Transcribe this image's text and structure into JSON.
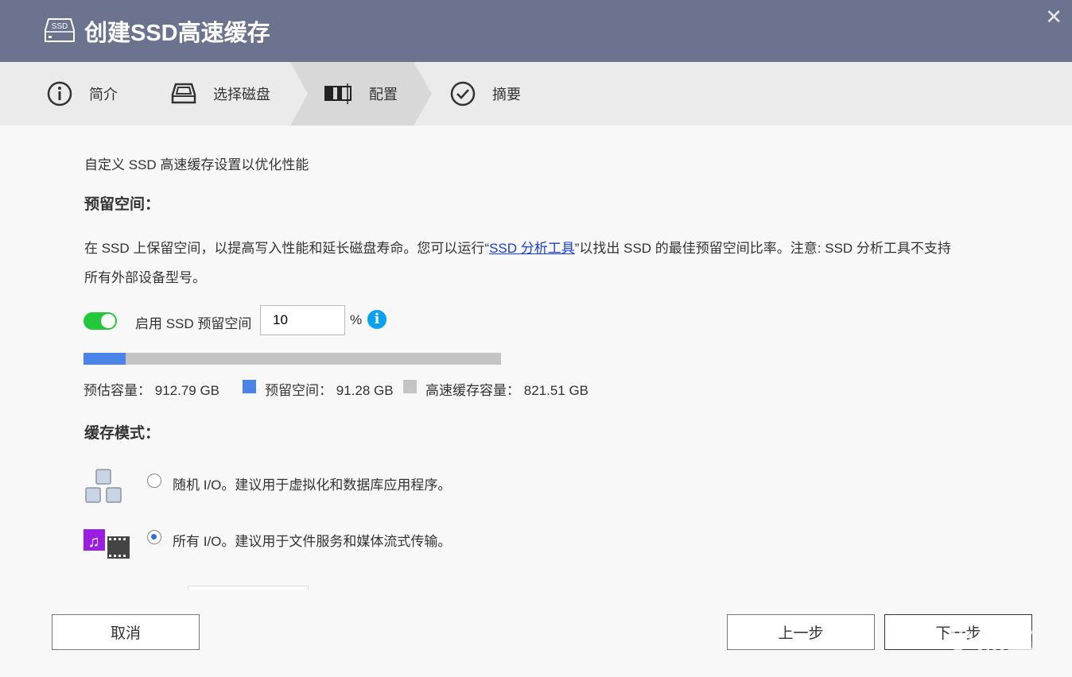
{
  "window": {
    "title": "创建SSD高速缓存",
    "logo_text": "SSD",
    "close_icon": "close-icon"
  },
  "steps": [
    {
      "label": "简介",
      "icon": "info-circle-icon"
    },
    {
      "label": "选择磁盘",
      "icon": "disk-drive-icon"
    },
    {
      "label": "配置",
      "icon": "config-icon",
      "active": true
    },
    {
      "label": "摘要",
      "icon": "check-circle-icon"
    }
  ],
  "main": {
    "subtitle": "自定义 SSD 高速缓存设置以优化性能",
    "reserve": {
      "heading": "预留空间：",
      "desc_1": "在 SSD 上保留空间，以提高写入性能和延长磁盘寿命。您可以运行“",
      "link": "SSD 分析工具",
      "desc_2": "”以找出 SSD 的最佳预留空间比率。注意: SSD 分析工具不支持",
      "desc_3": "所有外部设备型号。",
      "toggle_label": "启用 SSD 预留空间",
      "toggle_on": true,
      "value": "10",
      "unit": "%",
      "reserved_percent": 10,
      "estimated_label": "预估容量：",
      "estimated_value": "912.79 GB",
      "reserved_label": "预留空间：",
      "reserved_value": "91.28 GB",
      "cache_label": "高速缓存容量：",
      "cache_value": "821.51 GB",
      "colors": {
        "reserved": "#4a84e8",
        "cache": "#c4c4c4",
        "toggle": "#23c93b"
      }
    },
    "mode": {
      "heading": "缓存模式：",
      "options": [
        {
          "label": "随机 I/O。建议用于虚拟化和数据库应用程序。",
          "icon": "cubes-icon",
          "selected": false
        },
        {
          "label": "所有 I/O。建议用于文件服务和媒体流式传输。",
          "icon": "media-icon",
          "selected": true
        }
      ]
    }
  },
  "footer": {
    "cancel": "取消",
    "back": "上一步",
    "next": "下一步"
  },
  "watermark": "小黑盒"
}
